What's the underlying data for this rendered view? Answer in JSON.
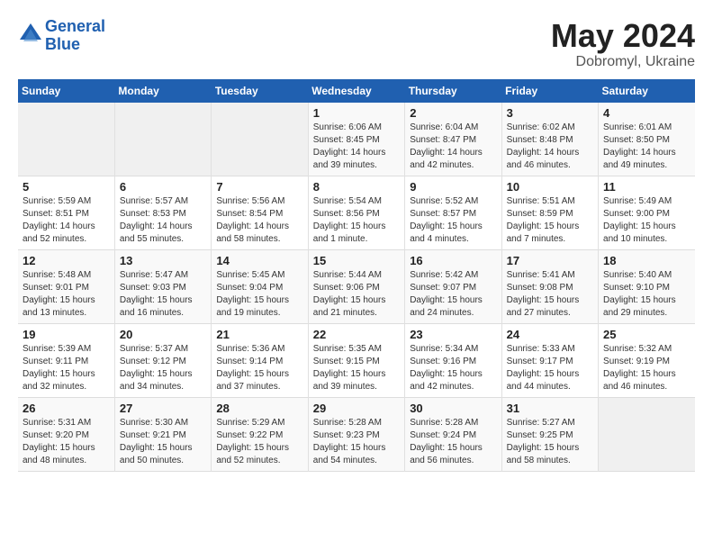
{
  "header": {
    "logo_line1": "General",
    "logo_line2": "Blue",
    "month": "May 2024",
    "location": "Dobromyl, Ukraine"
  },
  "weekdays": [
    "Sunday",
    "Monday",
    "Tuesday",
    "Wednesday",
    "Thursday",
    "Friday",
    "Saturday"
  ],
  "weeks": [
    [
      {
        "day": "",
        "info": ""
      },
      {
        "day": "",
        "info": ""
      },
      {
        "day": "",
        "info": ""
      },
      {
        "day": "1",
        "info": "Sunrise: 6:06 AM\nSunset: 8:45 PM\nDaylight: 14 hours\nand 39 minutes."
      },
      {
        "day": "2",
        "info": "Sunrise: 6:04 AM\nSunset: 8:47 PM\nDaylight: 14 hours\nand 42 minutes."
      },
      {
        "day": "3",
        "info": "Sunrise: 6:02 AM\nSunset: 8:48 PM\nDaylight: 14 hours\nand 46 minutes."
      },
      {
        "day": "4",
        "info": "Sunrise: 6:01 AM\nSunset: 8:50 PM\nDaylight: 14 hours\nand 49 minutes."
      }
    ],
    [
      {
        "day": "5",
        "info": "Sunrise: 5:59 AM\nSunset: 8:51 PM\nDaylight: 14 hours\nand 52 minutes."
      },
      {
        "day": "6",
        "info": "Sunrise: 5:57 AM\nSunset: 8:53 PM\nDaylight: 14 hours\nand 55 minutes."
      },
      {
        "day": "7",
        "info": "Sunrise: 5:56 AM\nSunset: 8:54 PM\nDaylight: 14 hours\nand 58 minutes."
      },
      {
        "day": "8",
        "info": "Sunrise: 5:54 AM\nSunset: 8:56 PM\nDaylight: 15 hours\nand 1 minute."
      },
      {
        "day": "9",
        "info": "Sunrise: 5:52 AM\nSunset: 8:57 PM\nDaylight: 15 hours\nand 4 minutes."
      },
      {
        "day": "10",
        "info": "Sunrise: 5:51 AM\nSunset: 8:59 PM\nDaylight: 15 hours\nand 7 minutes."
      },
      {
        "day": "11",
        "info": "Sunrise: 5:49 AM\nSunset: 9:00 PM\nDaylight: 15 hours\nand 10 minutes."
      }
    ],
    [
      {
        "day": "12",
        "info": "Sunrise: 5:48 AM\nSunset: 9:01 PM\nDaylight: 15 hours\nand 13 minutes."
      },
      {
        "day": "13",
        "info": "Sunrise: 5:47 AM\nSunset: 9:03 PM\nDaylight: 15 hours\nand 16 minutes."
      },
      {
        "day": "14",
        "info": "Sunrise: 5:45 AM\nSunset: 9:04 PM\nDaylight: 15 hours\nand 19 minutes."
      },
      {
        "day": "15",
        "info": "Sunrise: 5:44 AM\nSunset: 9:06 PM\nDaylight: 15 hours\nand 21 minutes."
      },
      {
        "day": "16",
        "info": "Sunrise: 5:42 AM\nSunset: 9:07 PM\nDaylight: 15 hours\nand 24 minutes."
      },
      {
        "day": "17",
        "info": "Sunrise: 5:41 AM\nSunset: 9:08 PM\nDaylight: 15 hours\nand 27 minutes."
      },
      {
        "day": "18",
        "info": "Sunrise: 5:40 AM\nSunset: 9:10 PM\nDaylight: 15 hours\nand 29 minutes."
      }
    ],
    [
      {
        "day": "19",
        "info": "Sunrise: 5:39 AM\nSunset: 9:11 PM\nDaylight: 15 hours\nand 32 minutes."
      },
      {
        "day": "20",
        "info": "Sunrise: 5:37 AM\nSunset: 9:12 PM\nDaylight: 15 hours\nand 34 minutes."
      },
      {
        "day": "21",
        "info": "Sunrise: 5:36 AM\nSunset: 9:14 PM\nDaylight: 15 hours\nand 37 minutes."
      },
      {
        "day": "22",
        "info": "Sunrise: 5:35 AM\nSunset: 9:15 PM\nDaylight: 15 hours\nand 39 minutes."
      },
      {
        "day": "23",
        "info": "Sunrise: 5:34 AM\nSunset: 9:16 PM\nDaylight: 15 hours\nand 42 minutes."
      },
      {
        "day": "24",
        "info": "Sunrise: 5:33 AM\nSunset: 9:17 PM\nDaylight: 15 hours\nand 44 minutes."
      },
      {
        "day": "25",
        "info": "Sunrise: 5:32 AM\nSunset: 9:19 PM\nDaylight: 15 hours\nand 46 minutes."
      }
    ],
    [
      {
        "day": "26",
        "info": "Sunrise: 5:31 AM\nSunset: 9:20 PM\nDaylight: 15 hours\nand 48 minutes."
      },
      {
        "day": "27",
        "info": "Sunrise: 5:30 AM\nSunset: 9:21 PM\nDaylight: 15 hours\nand 50 minutes."
      },
      {
        "day": "28",
        "info": "Sunrise: 5:29 AM\nSunset: 9:22 PM\nDaylight: 15 hours\nand 52 minutes."
      },
      {
        "day": "29",
        "info": "Sunrise: 5:28 AM\nSunset: 9:23 PM\nDaylight: 15 hours\nand 54 minutes."
      },
      {
        "day": "30",
        "info": "Sunrise: 5:28 AM\nSunset: 9:24 PM\nDaylight: 15 hours\nand 56 minutes."
      },
      {
        "day": "31",
        "info": "Sunrise: 5:27 AM\nSunset: 9:25 PM\nDaylight: 15 hours\nand 58 minutes."
      },
      {
        "day": "",
        "info": ""
      }
    ]
  ]
}
